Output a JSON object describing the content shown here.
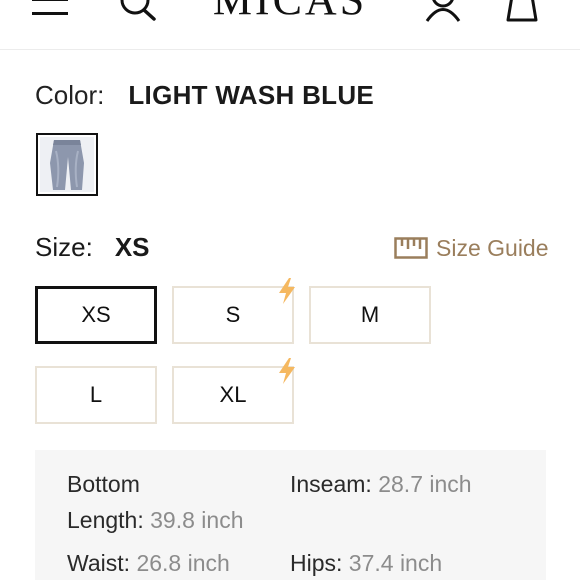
{
  "header": {
    "logo_text": "MICAS",
    "icons": [
      "menu-icon",
      "search-icon",
      "account-icon",
      "shopping-bag-icon"
    ]
  },
  "color": {
    "label": "Color:",
    "value": "LIGHT WASH BLUE",
    "swatch_icon": "jeans-thumbnail"
  },
  "size": {
    "label": "Size:",
    "selected": "XS",
    "guide_label": "Size Guide",
    "options": [
      {
        "label": "XS",
        "selected": true,
        "low_stock": false
      },
      {
        "label": "S",
        "selected": false,
        "low_stock": true
      },
      {
        "label": "M",
        "selected": false,
        "low_stock": false
      },
      {
        "label": "L",
        "selected": false,
        "low_stock": false
      },
      {
        "label": "XL",
        "selected": false,
        "low_stock": true
      }
    ]
  },
  "measurements": {
    "bottom_label": "Bottom",
    "length_label": "Length:",
    "length_value": "39.8 inch",
    "inseam_label": "Inseam:",
    "inseam_value": "28.7 inch",
    "waist_label": "Waist:",
    "waist_value": "26.8 inch",
    "hips_label": "Hips:",
    "hips_value": "37.4 inch"
  },
  "colors": {
    "accent_gold": "#9a7e5c",
    "bolt_orange": "#f5b860",
    "selected_border": "#111111",
    "option_border": "#e9e2d6",
    "panel_bg": "#f6f6f6"
  }
}
